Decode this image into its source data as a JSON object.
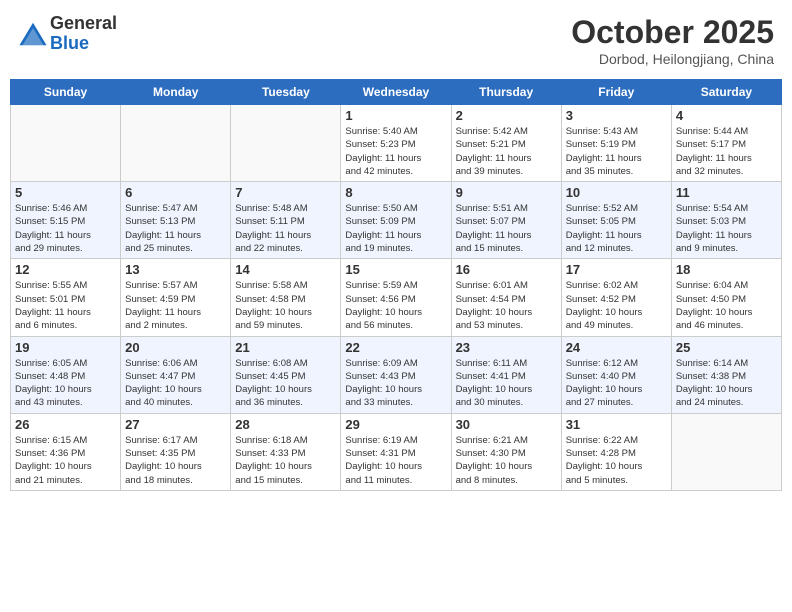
{
  "header": {
    "logo_general": "General",
    "logo_blue": "Blue",
    "month": "October 2025",
    "location": "Dorbod, Heilongjiang, China"
  },
  "weekdays": [
    "Sunday",
    "Monday",
    "Tuesday",
    "Wednesday",
    "Thursday",
    "Friday",
    "Saturday"
  ],
  "weeks": [
    {
      "shaded": false,
      "days": [
        {
          "num": "",
          "info": ""
        },
        {
          "num": "",
          "info": ""
        },
        {
          "num": "",
          "info": ""
        },
        {
          "num": "1",
          "info": "Sunrise: 5:40 AM\nSunset: 5:23 PM\nDaylight: 11 hours\nand 42 minutes."
        },
        {
          "num": "2",
          "info": "Sunrise: 5:42 AM\nSunset: 5:21 PM\nDaylight: 11 hours\nand 39 minutes."
        },
        {
          "num": "3",
          "info": "Sunrise: 5:43 AM\nSunset: 5:19 PM\nDaylight: 11 hours\nand 35 minutes."
        },
        {
          "num": "4",
          "info": "Sunrise: 5:44 AM\nSunset: 5:17 PM\nDaylight: 11 hours\nand 32 minutes."
        }
      ]
    },
    {
      "shaded": true,
      "days": [
        {
          "num": "5",
          "info": "Sunrise: 5:46 AM\nSunset: 5:15 PM\nDaylight: 11 hours\nand 29 minutes."
        },
        {
          "num": "6",
          "info": "Sunrise: 5:47 AM\nSunset: 5:13 PM\nDaylight: 11 hours\nand 25 minutes."
        },
        {
          "num": "7",
          "info": "Sunrise: 5:48 AM\nSunset: 5:11 PM\nDaylight: 11 hours\nand 22 minutes."
        },
        {
          "num": "8",
          "info": "Sunrise: 5:50 AM\nSunset: 5:09 PM\nDaylight: 11 hours\nand 19 minutes."
        },
        {
          "num": "9",
          "info": "Sunrise: 5:51 AM\nSunset: 5:07 PM\nDaylight: 11 hours\nand 15 minutes."
        },
        {
          "num": "10",
          "info": "Sunrise: 5:52 AM\nSunset: 5:05 PM\nDaylight: 11 hours\nand 12 minutes."
        },
        {
          "num": "11",
          "info": "Sunrise: 5:54 AM\nSunset: 5:03 PM\nDaylight: 11 hours\nand 9 minutes."
        }
      ]
    },
    {
      "shaded": false,
      "days": [
        {
          "num": "12",
          "info": "Sunrise: 5:55 AM\nSunset: 5:01 PM\nDaylight: 11 hours\nand 6 minutes."
        },
        {
          "num": "13",
          "info": "Sunrise: 5:57 AM\nSunset: 4:59 PM\nDaylight: 11 hours\nand 2 minutes."
        },
        {
          "num": "14",
          "info": "Sunrise: 5:58 AM\nSunset: 4:58 PM\nDaylight: 10 hours\nand 59 minutes."
        },
        {
          "num": "15",
          "info": "Sunrise: 5:59 AM\nSunset: 4:56 PM\nDaylight: 10 hours\nand 56 minutes."
        },
        {
          "num": "16",
          "info": "Sunrise: 6:01 AM\nSunset: 4:54 PM\nDaylight: 10 hours\nand 53 minutes."
        },
        {
          "num": "17",
          "info": "Sunrise: 6:02 AM\nSunset: 4:52 PM\nDaylight: 10 hours\nand 49 minutes."
        },
        {
          "num": "18",
          "info": "Sunrise: 6:04 AM\nSunset: 4:50 PM\nDaylight: 10 hours\nand 46 minutes."
        }
      ]
    },
    {
      "shaded": true,
      "days": [
        {
          "num": "19",
          "info": "Sunrise: 6:05 AM\nSunset: 4:48 PM\nDaylight: 10 hours\nand 43 minutes."
        },
        {
          "num": "20",
          "info": "Sunrise: 6:06 AM\nSunset: 4:47 PM\nDaylight: 10 hours\nand 40 minutes."
        },
        {
          "num": "21",
          "info": "Sunrise: 6:08 AM\nSunset: 4:45 PM\nDaylight: 10 hours\nand 36 minutes."
        },
        {
          "num": "22",
          "info": "Sunrise: 6:09 AM\nSunset: 4:43 PM\nDaylight: 10 hours\nand 33 minutes."
        },
        {
          "num": "23",
          "info": "Sunrise: 6:11 AM\nSunset: 4:41 PM\nDaylight: 10 hours\nand 30 minutes."
        },
        {
          "num": "24",
          "info": "Sunrise: 6:12 AM\nSunset: 4:40 PM\nDaylight: 10 hours\nand 27 minutes."
        },
        {
          "num": "25",
          "info": "Sunrise: 6:14 AM\nSunset: 4:38 PM\nDaylight: 10 hours\nand 24 minutes."
        }
      ]
    },
    {
      "shaded": false,
      "days": [
        {
          "num": "26",
          "info": "Sunrise: 6:15 AM\nSunset: 4:36 PM\nDaylight: 10 hours\nand 21 minutes."
        },
        {
          "num": "27",
          "info": "Sunrise: 6:17 AM\nSunset: 4:35 PM\nDaylight: 10 hours\nand 18 minutes."
        },
        {
          "num": "28",
          "info": "Sunrise: 6:18 AM\nSunset: 4:33 PM\nDaylight: 10 hours\nand 15 minutes."
        },
        {
          "num": "29",
          "info": "Sunrise: 6:19 AM\nSunset: 4:31 PM\nDaylight: 10 hours\nand 11 minutes."
        },
        {
          "num": "30",
          "info": "Sunrise: 6:21 AM\nSunset: 4:30 PM\nDaylight: 10 hours\nand 8 minutes."
        },
        {
          "num": "31",
          "info": "Sunrise: 6:22 AM\nSunset: 4:28 PM\nDaylight: 10 hours\nand 5 minutes."
        },
        {
          "num": "",
          "info": ""
        }
      ]
    }
  ]
}
